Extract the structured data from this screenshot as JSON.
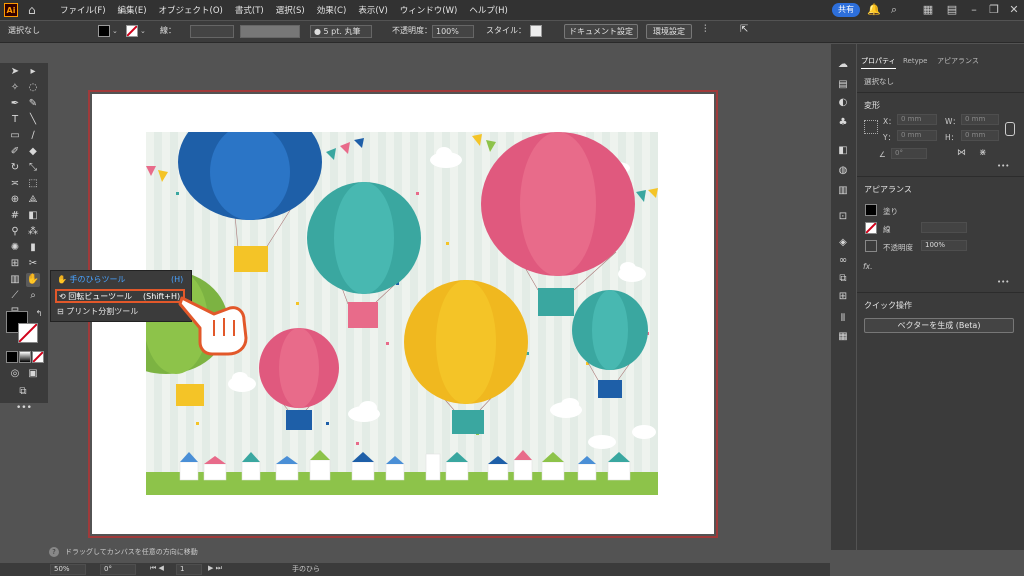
{
  "app": {
    "logo": "Ai",
    "home_icon": "home-icon"
  },
  "menu": [
    "ファイル(F)",
    "編集(E)",
    "オブジェクト(O)",
    "書式(T)",
    "選択(S)",
    "効果(C)",
    "表示(V)",
    "ウィンドウ(W)",
    "ヘルプ(H)"
  ],
  "menubar_right": {
    "share_label": "共有"
  },
  "control": {
    "selection": "選択なし",
    "stroke_label": "線：",
    "brush_label": "5 pt. 丸筆",
    "opacity_label": "不透明度：",
    "opacity_value": "100%",
    "style_label": "スタイル：",
    "doc_settings": "ドキュメント設定",
    "env_settings": "環境設定"
  },
  "flyout": {
    "hand_tool": "手のひらツール",
    "hand_shortcut": "(H)",
    "rotate_view_tool": "回転ビューツール",
    "rotate_shortcut": "(Shift+H)",
    "print_tiling_tool": "プリント分割ツール"
  },
  "panel": {
    "tabs": [
      "プロパティ",
      "Retype",
      "アピアランス"
    ],
    "selection": "選択なし",
    "transform_title": "変形",
    "x_label": "X：",
    "y_label": "Y：",
    "w_label": "W：",
    "h_label": "H：",
    "x_value": "0 mm",
    "y_value": "0 mm",
    "w_value": "0 mm",
    "h_value": "0 mm",
    "angle_value": "0°",
    "appearance_title": "アピアランス",
    "fill_label": "塗り",
    "stroke_label": "線",
    "opacity_label": "不透明度",
    "opacity_value": "100%",
    "fx_label": "fx.",
    "quick_title": "クイック操作",
    "vectorize_button": "ベクターを生成 (Beta)"
  },
  "hint": "ドラッグしてカンバスを任意の方向に移動",
  "status": {
    "zoom": "50%",
    "rotation": "0°",
    "artboard": "1",
    "tool": "手のひら"
  },
  "colors": {
    "accent": "#2d6fdb",
    "highlight": "#e2582a",
    "artboard_border": "#a03a3a"
  }
}
